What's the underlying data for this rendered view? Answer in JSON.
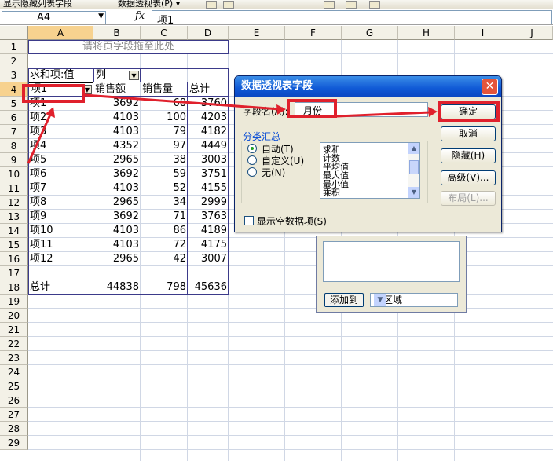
{
  "toolbar": {
    "left_text": "显示隐藏列表字段",
    "pivot_menu": "数据透视表(P) ▾"
  },
  "formula_bar": {
    "cell_ref": "A4",
    "fx": "fx",
    "value": "项1"
  },
  "grid": {
    "columns": [
      "A",
      "B",
      "C",
      "D",
      "E",
      "F",
      "G",
      "H",
      "I",
      "J"
    ],
    "rows": [
      "1",
      "2",
      "3",
      "4",
      "5",
      "6",
      "7",
      "8",
      "9",
      "10",
      "11",
      "12",
      "13",
      "14",
      "15",
      "16",
      "17",
      "18",
      "19",
      "20",
      "21",
      "22",
      "23",
      "24",
      "25",
      "26",
      "27",
      "28",
      "29"
    ]
  },
  "pivot": {
    "page_drop": "请将页字段拖至此处",
    "data_label": "求和项:值",
    "col_field": "列",
    "row_field": "项1",
    "headers": [
      "销售额",
      "销售量",
      "总计"
    ],
    "rows": [
      {
        "label": "项1",
        "sales": "3692",
        "qty": "68",
        "total": "3760"
      },
      {
        "label": "项2",
        "sales": "4103",
        "qty": "100",
        "total": "4203"
      },
      {
        "label": "项3",
        "sales": "4103",
        "qty": "79",
        "total": "4182"
      },
      {
        "label": "项4",
        "sales": "4352",
        "qty": "97",
        "total": "4449"
      },
      {
        "label": "项5",
        "sales": "2965",
        "qty": "38",
        "total": "3003"
      },
      {
        "label": "项6",
        "sales": "3692",
        "qty": "59",
        "total": "3751"
      },
      {
        "label": "项7",
        "sales": "4103",
        "qty": "52",
        "total": "4155"
      },
      {
        "label": "项8",
        "sales": "2965",
        "qty": "34",
        "total": "2999"
      },
      {
        "label": "项9",
        "sales": "3692",
        "qty": "71",
        "total": "3763"
      },
      {
        "label": "项10",
        "sales": "4103",
        "qty": "86",
        "total": "4189"
      },
      {
        "label": "项11",
        "sales": "4103",
        "qty": "72",
        "total": "4175"
      },
      {
        "label": "项12",
        "sales": "2965",
        "qty": "42",
        "total": "3007"
      }
    ],
    "grand_total": {
      "label": "总计",
      "sales": "44838",
      "qty": "798",
      "total": "45636"
    }
  },
  "dialog": {
    "title": "数据透视表字段",
    "name_label": "字段名(A):",
    "name_value": "月份",
    "ok": "确定",
    "cancel": "取消",
    "hide": "隐藏(H)",
    "advanced": "高级(V)...",
    "layout": "布局(L)...",
    "subtotals_title": "分类汇总",
    "radio_auto": "自动(T)",
    "radio_custom": "自定义(U)",
    "radio_none": "无(N)",
    "functions": [
      "求和",
      "计数",
      "平均值",
      "最大值",
      "最小值",
      "乘积"
    ],
    "show_empty": "显示空数据项(S)"
  },
  "field_list": {
    "add_button": "添加到",
    "area": "行区域"
  },
  "colors": {
    "annotation_red": "#e0202c",
    "title_blue": "#1059d6",
    "close_red": "#e4553b"
  }
}
